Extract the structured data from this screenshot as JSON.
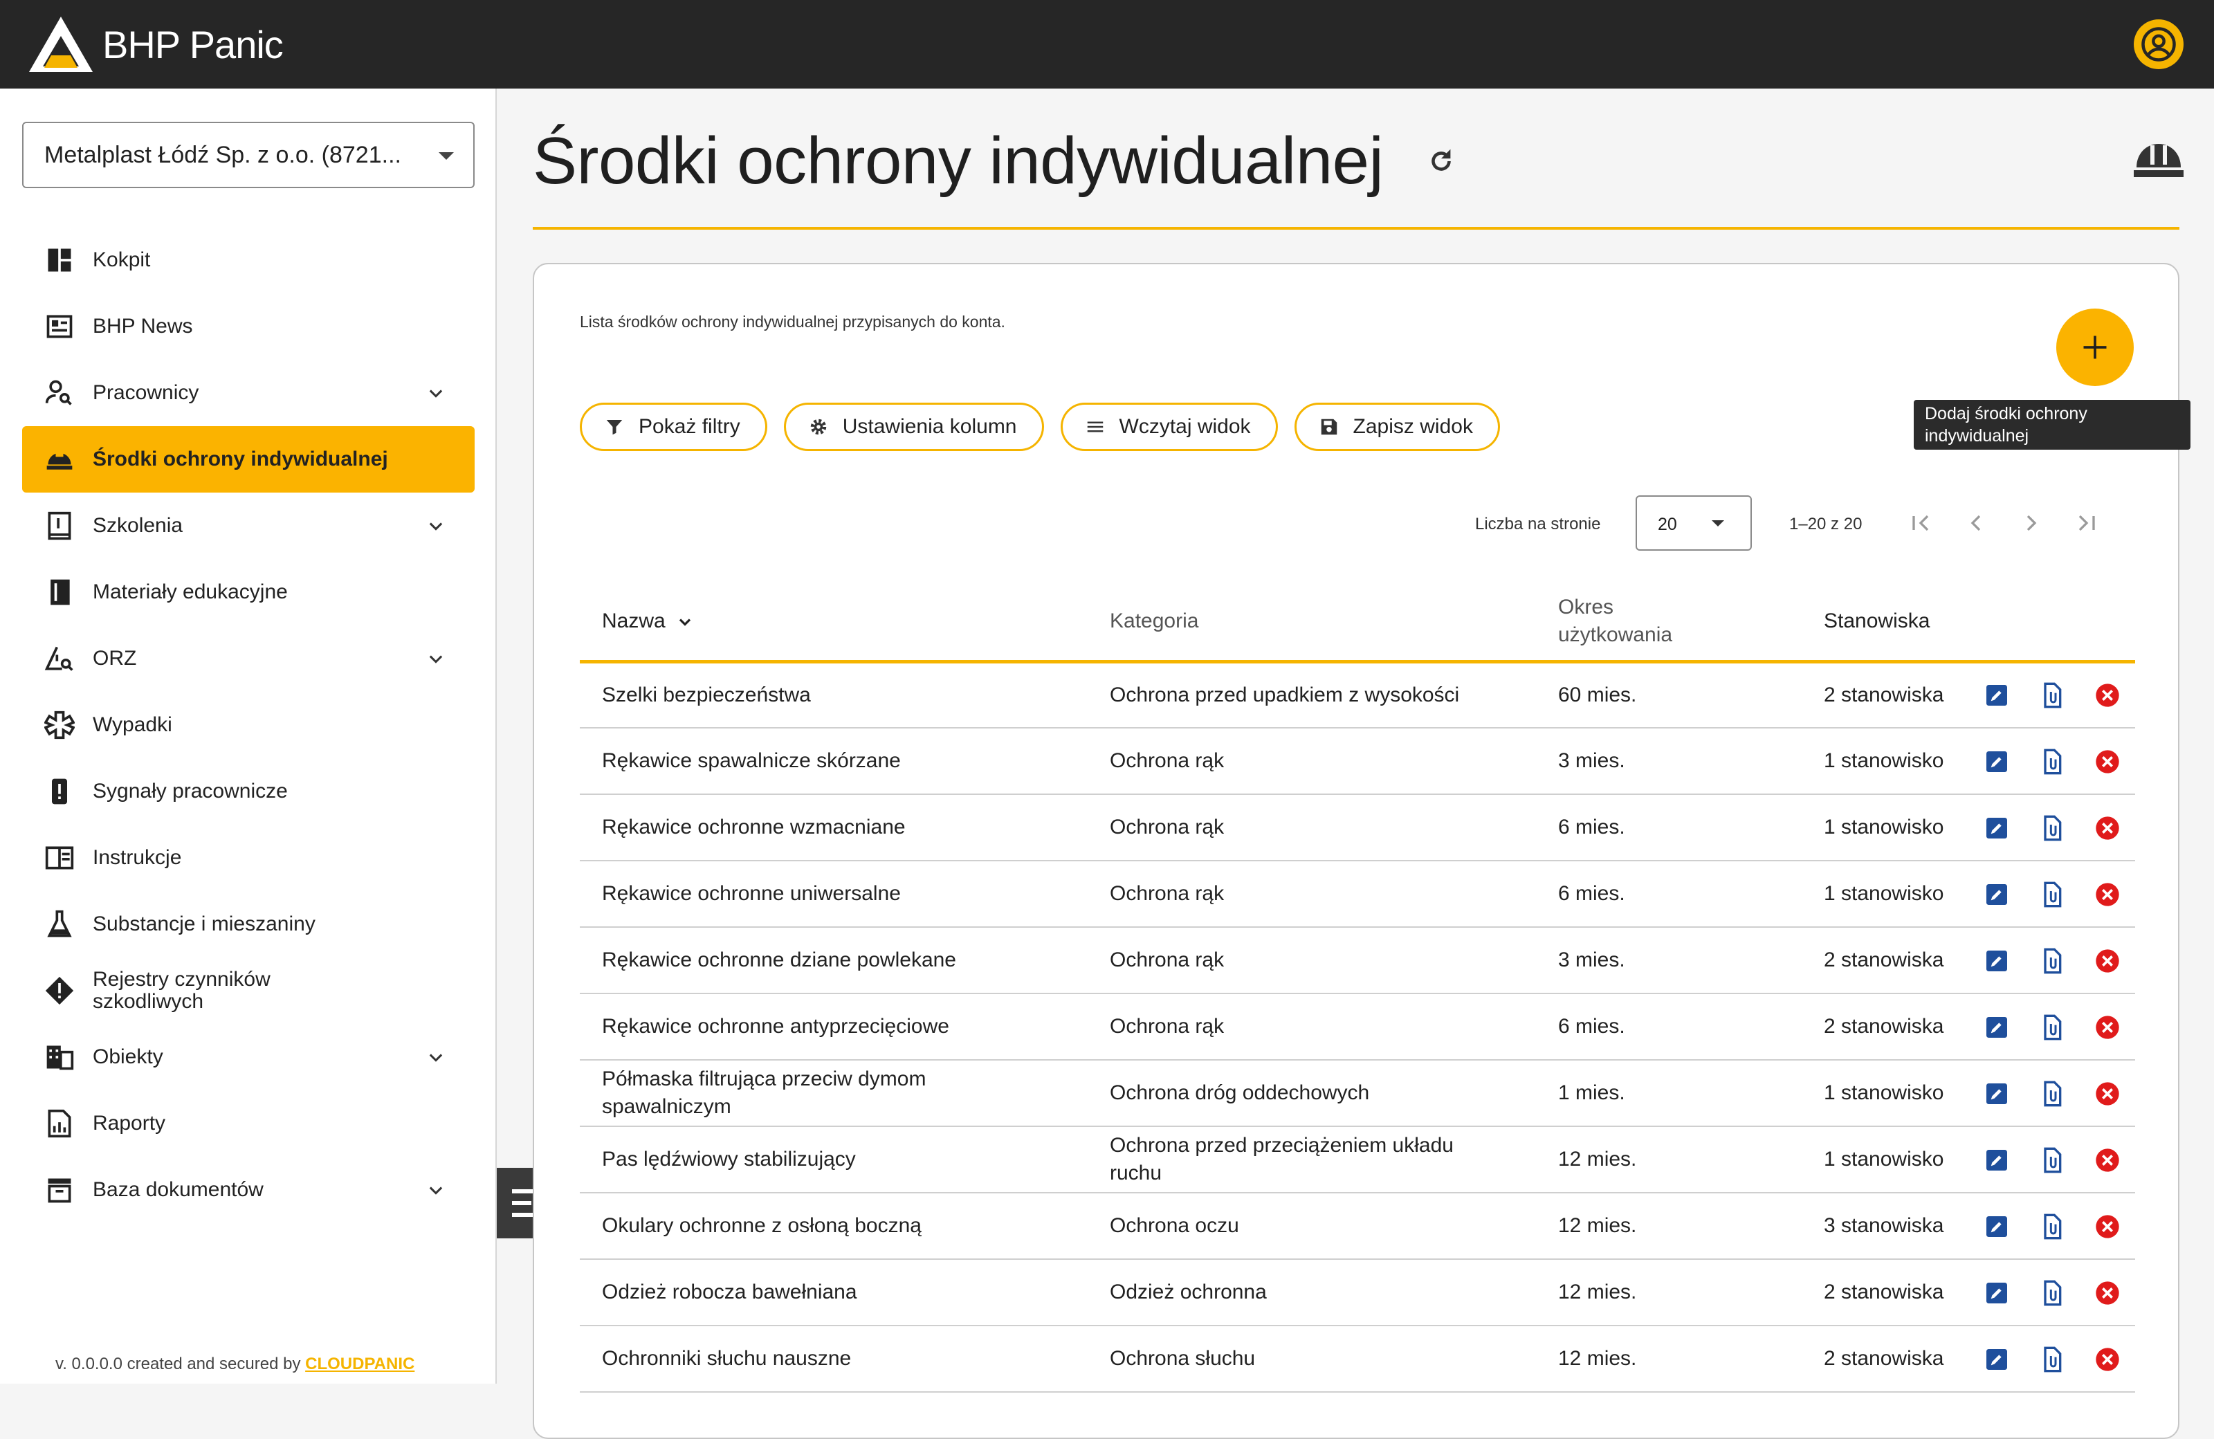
{
  "app": {
    "name": "BHP Panic"
  },
  "sidebar": {
    "company": "Metalplast Łódź Sp. z o.o. (8721...",
    "items": [
      {
        "label": "Kokpit",
        "icon": "dashboard-icon",
        "expandable": false,
        "active": false
      },
      {
        "label": "BHP News",
        "icon": "news-icon",
        "expandable": false,
        "active": false
      },
      {
        "label": "Pracownicy",
        "icon": "person-search-icon",
        "expandable": true,
        "active": false
      },
      {
        "label": "Środki ochrony indywidualnej",
        "icon": "helmet-icon",
        "expandable": false,
        "active": true
      },
      {
        "label": "Szkolenia",
        "icon": "training-book-icon",
        "expandable": true,
        "active": false
      },
      {
        "label": "Materiały edukacyjne",
        "icon": "book-icon",
        "expandable": false,
        "active": false
      },
      {
        "label": "ORZ",
        "icon": "warning-search-icon",
        "expandable": true,
        "active": false
      },
      {
        "label": "Wypadki",
        "icon": "medical-icon",
        "expandable": false,
        "active": false
      },
      {
        "label": "Sygnały pracownicze",
        "icon": "alert-icon",
        "expandable": false,
        "active": false
      },
      {
        "label": "Instrukcje",
        "icon": "instructions-icon",
        "expandable": false,
        "active": false
      },
      {
        "label": "Substancje i mieszaniny",
        "icon": "flask-icon",
        "expandable": false,
        "active": false
      },
      {
        "label": "Rejestry czynników szkodliwych",
        "icon": "hazard-icon",
        "expandable": false,
        "active": false
      },
      {
        "label": "Obiekty",
        "icon": "building-icon",
        "expandable": true,
        "active": false
      },
      {
        "label": "Raporty",
        "icon": "report-icon",
        "expandable": false,
        "active": false
      },
      {
        "label": "Baza dokumentów",
        "icon": "archive-icon",
        "expandable": true,
        "active": false
      }
    ],
    "version_prefix": "v. 0.0.0.0 created and secured by ",
    "version_brand": "CLOUDPANIC"
  },
  "page": {
    "title": "Środki ochrony indywidualnej",
    "description": "Lista środków ochrony indywidualnej przypisanych do konta.",
    "add_tooltip": "Dodaj środki ochrony indywidualnej",
    "chips": {
      "filters": "Pokaż filtry",
      "columns": "Ustawienia kolumn",
      "load_view": "Wczytaj widok",
      "save_view": "Zapisz widok"
    },
    "pager": {
      "per_page_label": "Liczba na stronie",
      "per_page_value": "20",
      "range": "1–20 z 20"
    }
  },
  "table": {
    "headers": {
      "name": "Nazwa",
      "category": "Kategoria",
      "period": "Okres użytkowania",
      "positions": "Stanowiska"
    },
    "rows": [
      {
        "name": "Szelki bezpieczeństwa",
        "category": "Ochrona przed upadkiem z wysokości",
        "period": "60 mies.",
        "positions": "2 stanowiska"
      },
      {
        "name": "Rękawice spawalnicze skórzane",
        "category": "Ochrona rąk",
        "period": "3 mies.",
        "positions": "1 stanowisko"
      },
      {
        "name": "Rękawice ochronne wzmacniane",
        "category": "Ochrona rąk",
        "period": "6 mies.",
        "positions": "1 stanowisko"
      },
      {
        "name": "Rękawice ochronne uniwersalne",
        "category": "Ochrona rąk",
        "period": "6 mies.",
        "positions": "1 stanowisko"
      },
      {
        "name": "Rękawice ochronne dziane powlekane",
        "category": "Ochrona rąk",
        "period": "3 mies.",
        "positions": "2 stanowiska"
      },
      {
        "name": "Rękawice ochronne antyprzecięciowe",
        "category": "Ochrona rąk",
        "period": "6 mies.",
        "positions": "2 stanowiska"
      },
      {
        "name": "Półmaska filtrująca przeciw dymom spawalniczym",
        "category": "Ochrona dróg oddechowych",
        "period": "1 mies.",
        "positions": "1 stanowisko"
      },
      {
        "name": "Pas lędźwiowy stabilizujący",
        "category": "Ochrona przed przeciążeniem układu ruchu",
        "period": "12 mies.",
        "positions": "1 stanowisko"
      },
      {
        "name": "Okulary ochronne z osłoną boczną",
        "category": "Ochrona oczu",
        "period": "12 mies.",
        "positions": "3 stanowiska"
      },
      {
        "name": "Odzież robocza bawełniana",
        "category": "Odzież ochronna",
        "period": "12 mies.",
        "positions": "2 stanowiska"
      },
      {
        "name": "Ochronniki słuchu nauszne",
        "category": "Ochrona słuchu",
        "period": "12 mies.",
        "positions": "2 stanowiska"
      }
    ]
  },
  "colors": {
    "accent": "#fbb300",
    "topbar": "#262626",
    "edit": "#1f4f9c",
    "delete": "#e01b1b"
  }
}
